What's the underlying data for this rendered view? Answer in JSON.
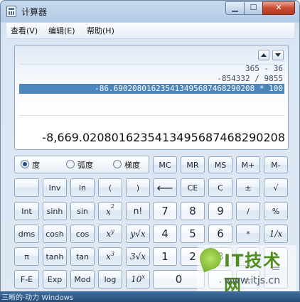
{
  "window": {
    "title": "计算器",
    "minimize_label": "▁",
    "maximize_label": "☐",
    "close_label": "✕"
  },
  "menu": {
    "items": [
      "查看(V)",
      "编辑(E)",
      "帮助(H)"
    ]
  },
  "display": {
    "history": [
      "365 - 36",
      "-854332 / 9855",
      "-86.690208016235413495687468290208 * 100"
    ],
    "selected_history_index": 2,
    "value": "-8,669.0208016235413495687468290208"
  },
  "angle_units": {
    "options": [
      "度",
      "弧度",
      "梯度"
    ],
    "selected": "度"
  },
  "keys": {
    "memory": [
      "MC",
      "MR",
      "MS",
      "M+",
      "M-"
    ],
    "row1": [
      "Inv",
      "ln",
      "(",
      ")",
      "⟵",
      "CE",
      "C",
      "±",
      "√"
    ],
    "row2": [
      "Int",
      "sinh",
      "sin",
      "x2",
      "n!",
      "7",
      "8",
      "9",
      "/",
      "%"
    ],
    "row3": [
      "dms",
      "cosh",
      "cos",
      "xy",
      "y√x",
      "4",
      "5",
      "6",
      "*",
      "1/x"
    ],
    "row4": [
      "π",
      "tanh",
      "tan",
      "x3",
      "3√x",
      "1",
      "2",
      "3",
      "-"
    ],
    "row5": [
      "F-E",
      "Exp",
      "Mod",
      "log",
      "10x",
      "0",
      "."
    ]
  },
  "watermark": {
    "brand": "IT技术网",
    "url": "www.itjs.cn"
  },
  "bottom_text": "三晰的·动力 Windows"
}
